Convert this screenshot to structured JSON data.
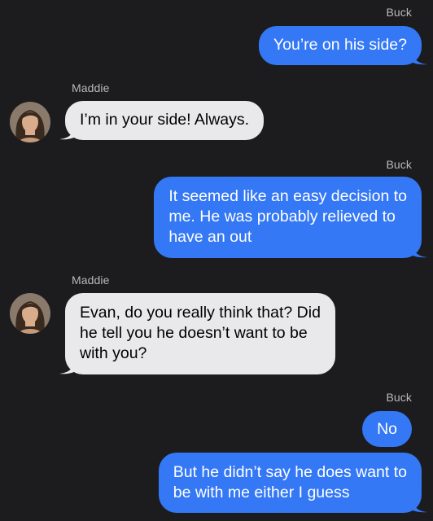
{
  "colors": {
    "background": "#1c1c1e",
    "outgoing_bubble": "#3478f6",
    "incoming_bubble": "#e9e9eb",
    "sender_label": "#b9b9bd"
  },
  "conversation": {
    "messages": [
      {
        "sender": "Buck",
        "direction": "outgoing",
        "lines": [
          "You’re on his side?"
        ]
      },
      {
        "sender": "Maddie",
        "direction": "incoming",
        "avatar": "contact-avatar-photo",
        "lines": [
          "I’m in your side! Always."
        ]
      },
      {
        "sender": "Buck",
        "direction": "outgoing",
        "lines": [
          "It seemed like an easy decision to",
          "me. He was probably relieved to",
          "have an out"
        ]
      },
      {
        "sender": "Maddie",
        "direction": "incoming",
        "avatar": "contact-avatar-photo",
        "lines": [
          "Evan, do you really think that? Did",
          "he tell you he doesn’t want to be",
          "with you?"
        ]
      },
      {
        "sender": "Buck",
        "direction": "outgoing",
        "lines": [
          "No"
        ]
      },
      {
        "direction": "outgoing",
        "lines": [
          "But he didn’t say he does want to",
          "be with me either I guess"
        ]
      }
    ]
  }
}
